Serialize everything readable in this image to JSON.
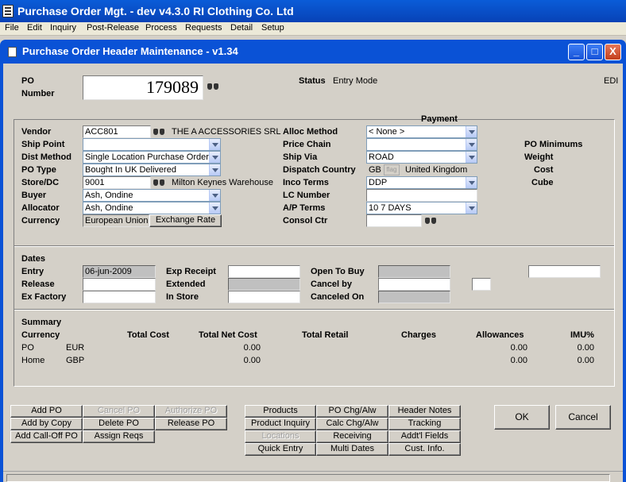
{
  "app": {
    "title": "Purchase Order Mgt. - dev v4.3.0 RI Clothing Co. Ltd"
  },
  "menu": [
    "File",
    "Edit",
    "Inquiry",
    "Post-Release",
    "Process",
    "Requests",
    "Detail",
    "Setup"
  ],
  "window": {
    "title": "Purchase Order Header Maintenance - v1.34",
    "min": "_",
    "max": "□",
    "close": "X"
  },
  "po": {
    "label_line1": "PO",
    "label_line2": "Number",
    "number": "179089",
    "status_label": "Status",
    "status_value": "Entry Mode",
    "edi": "EDI"
  },
  "left": {
    "vendor_label": "Vendor",
    "vendor_code": "ACC801",
    "vendor_name": "THE A ACCESSORIES SRL",
    "ship_point_label": "Ship Point",
    "ship_point_value": "",
    "dist_method_label": "Dist Method",
    "dist_method_value": "Single Location Purchase Order",
    "po_type_label": "PO Type",
    "po_type_value": "Bought In UK Delivered",
    "store_label": "Store/DC",
    "store_code": "9001",
    "store_name": "Milton Keynes Warehouse",
    "buyer_label": "Buyer",
    "buyer_value": "Ash, Ondine",
    "allocator_label": "Allocator",
    "allocator_value": "Ash, Ondine",
    "currency_label": "Currency",
    "currency_value": "European Union",
    "exchange_rate_button": "Exchange Rate"
  },
  "right": {
    "payment_header": "Payment",
    "alloc_method_label": "Alloc Method",
    "alloc_method_value": "< None >",
    "price_chain_label": "Price Chain",
    "price_chain_value": "",
    "ship_via_label": "Ship Via",
    "ship_via_value": "ROAD",
    "dispatch_country_label": "Dispatch Country",
    "dispatch_country_code": "GB",
    "dispatch_country_flag": "flag",
    "dispatch_country_name": "United Kingdom",
    "inco_terms_label": "Inco Terms",
    "inco_terms_value": "DDP",
    "lc_number_label": "LC Number",
    "lc_number_value": "",
    "ap_terms_label": "A/P Terms",
    "ap_terms_value": "10 7 DAYS",
    "consol_ctr_label": "Consol Ctr",
    "consol_ctr_value": ""
  },
  "minimums": {
    "header": "PO Minimums",
    "weight": "Weight",
    "cost": "Cost",
    "cube": "Cube"
  },
  "dates": {
    "header": "Dates",
    "entry_label": "Entry",
    "entry_value": "06-jun-2009",
    "release_label": "Release",
    "release_value": "",
    "ex_factory_label": "Ex Factory",
    "ex_factory_value": "",
    "exp_receipt_label": "Exp Receipt",
    "exp_receipt_value": "",
    "extended_label": "Extended",
    "extended_value": "",
    "in_store_label": "In Store",
    "in_store_value": "",
    "open_to_buy_label": "Open To Buy",
    "open_to_buy_value": "",
    "cancel_by_label": "Cancel by",
    "cancel_by_value": "",
    "canceled_on_label": "Canceled On",
    "canceled_on_value": ""
  },
  "summary": {
    "header": "Summary",
    "columns": [
      "Currency",
      "Total Cost",
      "Total Net Cost",
      "Total Retail",
      "Charges",
      "Allowances",
      "IMU%"
    ],
    "rows": [
      {
        "type": "PO",
        "currency": "EUR",
        "total_cost": "",
        "total_net_cost": "0.00",
        "total_retail": "",
        "charges": "",
        "allowances": "0.00",
        "imu": "0.00"
      },
      {
        "type": "Home",
        "currency": "GBP",
        "total_cost": "",
        "total_net_cost": "0.00",
        "total_retail": "",
        "charges": "",
        "allowances": "0.00",
        "imu": "0.00"
      }
    ]
  },
  "buttons": {
    "add_po": "Add PO",
    "cancel_po": "Cancel PO",
    "authorize_po": "Authorize PO",
    "add_by_copy": "Add by Copy",
    "delete_po": "Delete PO",
    "release_po": "Release PO",
    "add_call_off_po": "Add Call-Off PO",
    "assign_reqs": "Assign Reqs",
    "products": "Products",
    "po_chg_alw": "PO Chg/Alw",
    "header_notes": "Header Notes",
    "product_inquiry": "Product Inquiry",
    "calc_chg_alw": "Calc Chg/Alw",
    "tracking": "Tracking",
    "locations": "Locations",
    "receiving": "Receiving",
    "addtl_fields": "Addt'l Fields",
    "quick_entry": "Quick Entry",
    "multi_dates": "Multi Dates",
    "cust_info": "Cust. Info.",
    "ok": "OK",
    "cancel": "Cancel"
  }
}
